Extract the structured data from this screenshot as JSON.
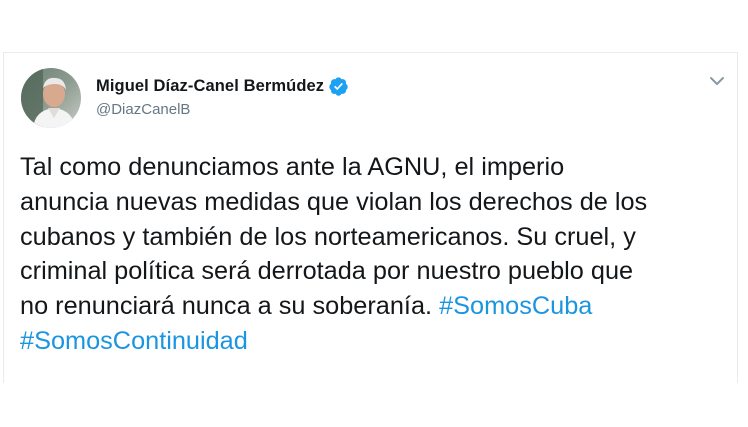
{
  "author": {
    "display_name": "Miguel Díaz-Canel Bermúdez",
    "handle": "@DiazCanelB",
    "verified": true
  },
  "tweet": {
    "line1": "Tal como denunciamos ante la AGNU, el imperio",
    "line2": "anuncia nuevas medidas que violan los derechos de los",
    "line3": "cubanos y también de los norteamericanos. Su cruel, y",
    "line4": "criminal política será derrotada por nuestro pueblo que",
    "line5_text": "no renunciará nunca a su soberanía. ",
    "hashtag1": "#SomosCuba",
    "hashtag2": "#SomosContinuidad"
  },
  "icons": {
    "verified": "verified-badge-icon",
    "menu": "chevron-down-icon"
  },
  "colors": {
    "text": "#14171a",
    "secondary": "#657786",
    "link": "#1b95e0",
    "verified": "#1da1f2"
  }
}
